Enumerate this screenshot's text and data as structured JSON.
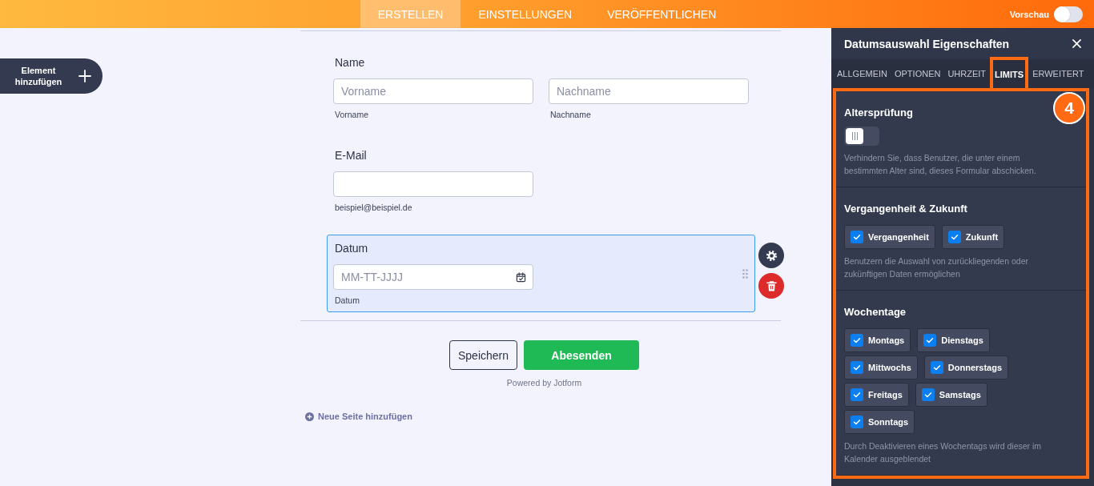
{
  "top_bar": {
    "tabs": [
      {
        "label": "ERSTELLEN",
        "selected": true
      },
      {
        "label": "EINSTELLUNGEN",
        "selected": false
      },
      {
        "label": "VERÖFFENTLICHEN",
        "selected": false
      }
    ],
    "preview": {
      "label": "Vorschau",
      "on": false
    }
  },
  "add_element_button": {
    "label": "Element hinzufügen"
  },
  "form": {
    "fields": [
      {
        "label": "Name",
        "selected": false,
        "inputs": [
          {
            "kind": "text",
            "placeholder": "Vorname",
            "sublabel": "Vorname"
          },
          {
            "kind": "text",
            "placeholder": "Nachname",
            "sublabel": "Nachname"
          }
        ]
      },
      {
        "label": "E-Mail",
        "selected": false,
        "inputs": [
          {
            "kind": "email",
            "sublabel": "beispiel@beispiel.de"
          }
        ]
      },
      {
        "label": "Datum",
        "selected": true,
        "inputs": [
          {
            "kind": "date",
            "placeholder": "MM-TT-JJJJ",
            "sublabel": "Datum"
          }
        ]
      }
    ],
    "buttons": [
      {
        "kind": "secondary",
        "label": "Speichern"
      },
      {
        "kind": "primary",
        "label": "Abesenden"
      }
    ],
    "powered_by": "Powered by Jotform",
    "add_page": "Neue Seite hinzufügen"
  },
  "panel": {
    "title": "Datumsauswahl Eigenschaften",
    "tabs": [
      {
        "label": "ALLGEMEIN",
        "selected": false
      },
      {
        "label": "OPTIONEN",
        "selected": false
      },
      {
        "label": "UHRZEIT",
        "selected": false
      },
      {
        "label": "LIMITS",
        "selected": true
      },
      {
        "label": "ERWEITERT",
        "selected": false
      }
    ],
    "sections": [
      {
        "kind": "toggle",
        "title": "Altersprüfung",
        "on": false,
        "description": "Verhindern Sie, dass Benutzer, die unter einem bestimmten Alter sind, dieses Formular abschicken."
      },
      {
        "kind": "checkboxes",
        "title": "Vergangenheit & Zukunft",
        "options": [
          {
            "label": "Vergangenheit",
            "checked": true
          },
          {
            "label": "Zukunft",
            "checked": true
          }
        ],
        "description": "Benutzern die Auswahl von zurückliegenden oder zukünftigen Daten ermöglichen"
      },
      {
        "kind": "checkboxes",
        "title": "Wochentage",
        "options": [
          {
            "label": "Montags",
            "checked": true
          },
          {
            "label": "Dienstags",
            "checked": true
          },
          {
            "label": "Mittwochs",
            "checked": true
          },
          {
            "label": "Donnerstags",
            "checked": true
          },
          {
            "label": "Freitags",
            "checked": true
          },
          {
            "label": "Samstags",
            "checked": true
          },
          {
            "label": "Sonntags",
            "checked": true
          }
        ],
        "description": "Durch Deaktivieren eines Wochentags wird dieser im Kalender ausgeblendet"
      }
    ]
  },
  "annotation": {
    "step": "4"
  }
}
